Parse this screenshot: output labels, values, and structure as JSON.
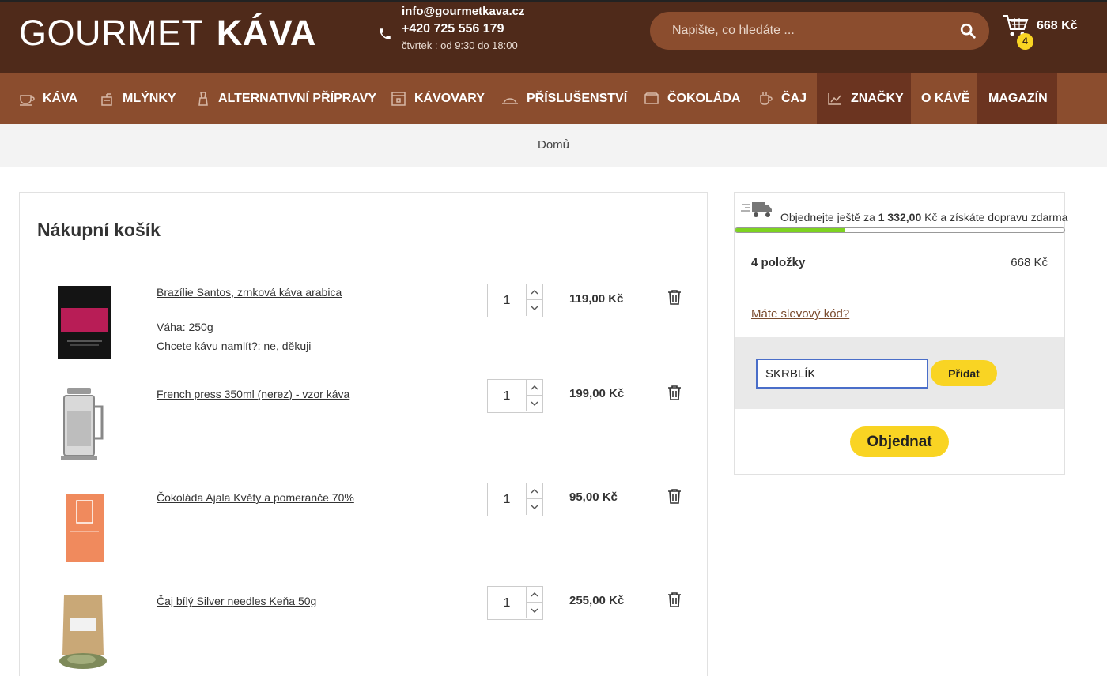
{
  "header": {
    "logo_regular": "GOURMET",
    "logo_bold": "KÁVA",
    "email": "info@gourmetkava.cz",
    "phone": "+420 725 556 179",
    "hours": "čtvrtek : od 9:30 do 18:00",
    "search_placeholder": "Napište, co hledáte ...",
    "cart_count": "4",
    "cart_total": "668 Kč"
  },
  "nav": {
    "items": [
      {
        "label": "KÁVA",
        "icon": "coffee-cup-icon"
      },
      {
        "label": "MLÝNKY",
        "icon": "grinder-icon"
      },
      {
        "label": "ALTERNATIVNÍ PŘÍPRAVY",
        "icon": "moka-pot-icon"
      },
      {
        "label": "KÁVOVARY",
        "icon": "espresso-machine-icon"
      },
      {
        "label": "PŘÍSLUŠENSTVÍ",
        "icon": "accessory-icon"
      },
      {
        "label": "ČOKOLÁDA",
        "icon": "chocolate-icon"
      },
      {
        "label": "ČAJ",
        "icon": "tea-icon"
      },
      {
        "label": "ZNAČKY",
        "icon": "brands-icon",
        "active": true
      },
      {
        "label": "O KÁVĚ"
      },
      {
        "label": "MAGAZÍN"
      }
    ]
  },
  "breadcrumb": "Domů",
  "cart": {
    "title": "Nákupní košík",
    "items": [
      {
        "name": "Brazílie Santos, zrnková káva arabica",
        "weight": "Váha: 250g",
        "grind": "Chcete kávu namlít?: ne, děkuji",
        "qty": "1",
        "price": "119,00 Kč",
        "thumb_color": "#1a1a1a",
        "label_color": "#c2185b"
      },
      {
        "name": "French press 350ml (nerez) - vzor káva",
        "qty": "1",
        "price": "199,00 Kč"
      },
      {
        "name": "Čokoláda Ajala Květy a pomeranče 70%",
        "qty": "1",
        "price": "95,00 Kč",
        "thumb_color": "#f08a5d"
      },
      {
        "name": "Čaj bílý Silver needles Keňa 50g",
        "qty": "1",
        "price": "255,00 Kč",
        "thumb_color": "#c9a877"
      }
    ]
  },
  "summary": {
    "ship_prefix": "Objednejte ještě za ",
    "ship_amount": "1 332,00",
    "ship_suffix": " Kč a získáte dopravu zdarma",
    "progress": 0.335,
    "progress_color": "#7ed321",
    "items_count": "4 položky",
    "items_total": "668 Kč",
    "discount_link": "Máte slevový kód?",
    "coupon_value": "SKRBLÍK",
    "add_label": "Přidat",
    "order_label": "Objednat"
  },
  "colors": {
    "header_bg": "#4f2a1a",
    "nav_bg": "#8b4d2e",
    "accent": "#f9d423"
  }
}
